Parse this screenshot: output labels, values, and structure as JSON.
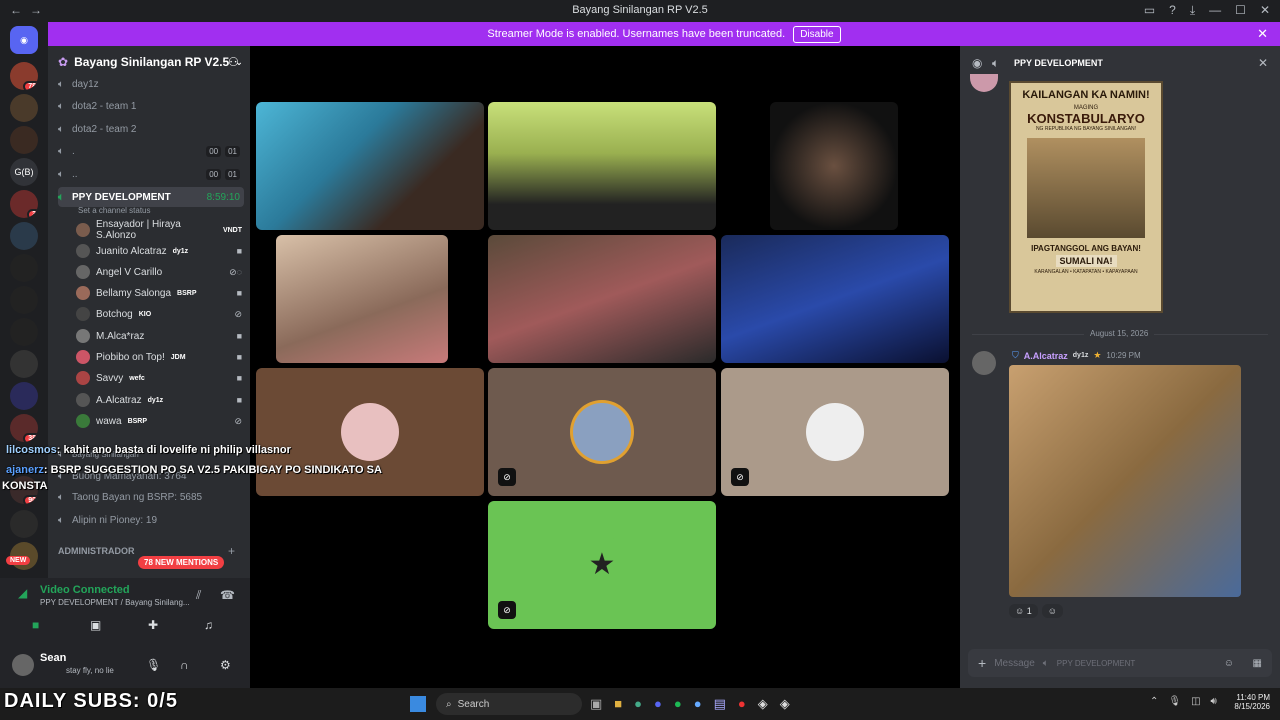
{
  "window": {
    "title": "Bayang Sinilangan RP V2.5"
  },
  "banner": {
    "text": "Streamer Mode is enabled. Usernames have been truncated.",
    "button": "Disable"
  },
  "server": {
    "name": "Bayang Sinilangan RP V2.5"
  },
  "rail_badges": [
    "78",
    "3",
    "38",
    "90",
    "NEW"
  ],
  "channels": [
    {
      "name": "day1z"
    },
    {
      "name": "dota2 - team 1"
    },
    {
      "name": "dota2 - team 2"
    },
    {
      "name": ".",
      "t1": "00",
      "t2": "01"
    },
    {
      "name": "..",
      "t1": "00",
      "t2": "01"
    },
    {
      "name": "PPY DEVELOPMENT",
      "timer": "8:59:10",
      "status": "Set a channel status"
    }
  ],
  "voice_users": [
    {
      "name": "Ensayador | Hiraya S.Alonzo",
      "tag": "VNDT"
    },
    {
      "name": "Juanito Alcatraz",
      "tag": "dy1z"
    },
    {
      "name": "Angel V Carillo",
      "tag": ""
    },
    {
      "name": "Bellamy Salonga",
      "tag": "BSRP"
    },
    {
      "name": "Botchog",
      "tag": "KIO"
    },
    {
      "name": "M.Alca*raz",
      "tag": ""
    },
    {
      "name": "Piobibo on Top!",
      "tag": "JDM"
    },
    {
      "name": "Savvy",
      "tag": "wefc"
    },
    {
      "name": "A.Alcatraz",
      "tag": "dy1z"
    },
    {
      "name": "wawa",
      "tag": "BSRP"
    }
  ],
  "lower_channels": [
    {
      "name": "Bayang Sinilangan"
    },
    {
      "name": "Buong Mamayanan: 3764"
    },
    {
      "name": "Taong Bayan ng BSRP: 5685"
    },
    {
      "name": "Alipin ni Pioney: 19"
    }
  ],
  "category": {
    "name": "ADMINISTRADOR"
  },
  "mentions_pill": "78 NEW MENTIONS",
  "overlay_chat": [
    {
      "user": "lilcosmos",
      "text": ": kahit ano basta di lovelife ni philip villasnor"
    },
    {
      "user": "ajanerz",
      "text": ": BSRP SUGGESTION PO SA V2.5 PAKIBIGAY PO SINDIKATO SA"
    },
    {
      "user": "KONSTA",
      "text": ""
    }
  ],
  "voice_panel": {
    "status": "Video Connected",
    "sub": "PPY DEVELOPMENT / Bayang Sinilang..."
  },
  "account": {
    "name": "Sean",
    "status": "stay fly, no lie"
  },
  "overlay_subs": "DAILY SUBS: 0/5",
  "chat": {
    "channel": "PPY DEVELOPMENT",
    "poster_lines": [
      "KAILANGAN KA NAMIN!",
      "MAGING",
      "KONSTABULARYO",
      "NG REPUBLIKA NG BAYANG SINILANGAN!",
      "IPAGTANGGOL ANG BAYAN!",
      "SUMALI NA!",
      "KARANGALAN • KATAPATAN • KAPAYAPAAN"
    ],
    "date_divider": "August 15, 2026",
    "msg_user": "A.Alcatraz",
    "msg_tag": "dy1z",
    "msg_time": "10:29 PM",
    "reaction_count": "1",
    "input_placeholder": "Message",
    "input_channel": "PPY DEVELOPMENT"
  },
  "taskbar": {
    "search": "Search",
    "time": "11:40 PM",
    "date": "8/15/2026"
  },
  "colors": {
    "accent": "#a12ff0",
    "green": "#23a55a",
    "red": "#f23f43"
  }
}
